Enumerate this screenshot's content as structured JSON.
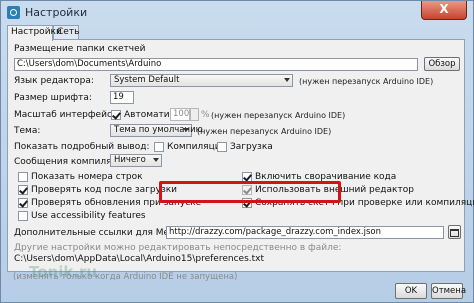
{
  "window": {
    "title": "Настройки",
    "close_label": "X"
  },
  "tabs": [
    {
      "label": "Настройки"
    },
    {
      "label": "Сеть"
    }
  ],
  "sketchbook": {
    "label": "Размещение папки скетчей",
    "value": "C:\\Users\\dom\\Documents\\Arduino",
    "browse_label": "Обзор"
  },
  "editor_language": {
    "label": "Язык редактора:",
    "value": "System Default",
    "note": "(нужен перезапуск Arduino IDE)"
  },
  "font_size": {
    "label": "Размер шрифта:",
    "value": "19"
  },
  "scale": {
    "label": "Масштаб интерфейса:",
    "auto_label": "Автоматика",
    "value": "100",
    "unit": "%",
    "note": "(нужен перезапуск Arduino IDE)"
  },
  "theme": {
    "label": "Тема:",
    "value": "Тема по умолчанию",
    "note": "(нужен перезапуск Arduino IDE)"
  },
  "verbose": {
    "label": "Показать подробный вывод:",
    "compile_label": "Компиляция",
    "upload_label": "Загрузка"
  },
  "warnings": {
    "label": "Сообщения компилятора:",
    "value": "Ничего"
  },
  "options_left": [
    {
      "label": "Показать номера строк",
      "checked": false
    },
    {
      "label": "Проверять код после загрузки",
      "checked": true
    },
    {
      "label": "Проверять обновления при запуске",
      "checked": true
    },
    {
      "label": "Use accessibility features",
      "checked": false
    }
  ],
  "options_right": [
    {
      "label": "Включить сворачивание кода",
      "checked": true
    },
    {
      "label": "Использовать внешний редактор",
      "checked": true
    },
    {
      "label": "Сохранять скетч при проверке или компиляции",
      "checked": true
    }
  ],
  "board_manager": {
    "label": "Дополнительные ссылки для Менеджера плат:",
    "value": "http://drazzy.com/package_drazzy.com_index.json"
  },
  "more_prefs": "Другие настройки можно редактировать непосредственно в файле:",
  "prefs_path": "C:\\Users\\dom\\AppData\\Local\\Arduino15\\preferences.txt",
  "edit_note": "(изменять только когда Arduino IDE не запущена)",
  "watermark": "Tonik.ru",
  "footer": {
    "ok_label": "OK",
    "cancel_label": "Отмена"
  },
  "colors": {
    "highlight": "#d21317",
    "close": "#c6442e"
  },
  "icons": {
    "app": "arduino-icon",
    "folder": "folder-icon"
  }
}
